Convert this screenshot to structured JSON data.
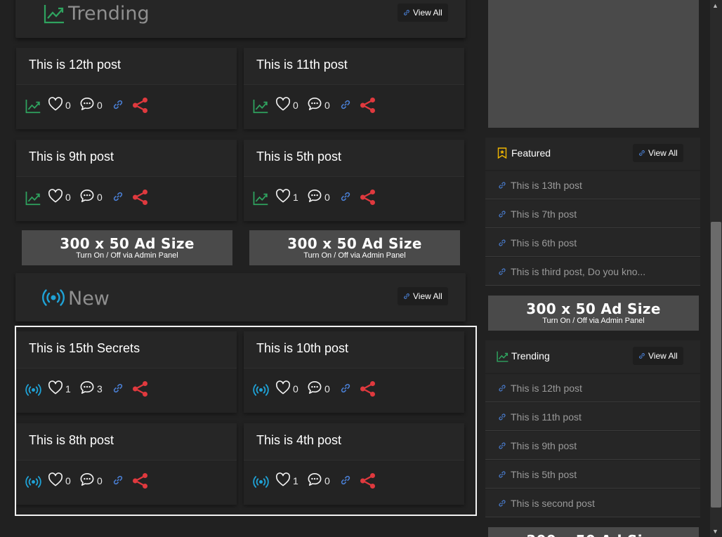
{
  "colors": {
    "trending_green": "#2fa35f",
    "new_blue": "#1fa2d6",
    "share_red": "#e0393e",
    "link_blue": "#4a7fd4",
    "featured_yellow": "#f0b600"
  },
  "trending": {
    "title": "Trending",
    "view_all": "View All",
    "icon": "trending-up-icon",
    "posts": [
      {
        "title": "This is 12th post",
        "likes": "0",
        "comments": "0"
      },
      {
        "title": "This is 11th post",
        "likes": "0",
        "comments": "0"
      },
      {
        "title": "This is 9th post",
        "likes": "0",
        "comments": "0"
      },
      {
        "title": "This is 5th post",
        "likes": "1",
        "comments": "0"
      }
    ]
  },
  "ads": {
    "line1": "300 x 50 Ad Size",
    "line2": "Turn On / Off via Admin Panel"
  },
  "new": {
    "title": "New",
    "view_all": "View All",
    "icon": "broadcast-icon",
    "posts": [
      {
        "title": "This is 15th Secrets",
        "likes": "1",
        "comments": "3"
      },
      {
        "title": "This is 10th post",
        "likes": "0",
        "comments": "0"
      },
      {
        "title": "This is 8th post",
        "likes": "0",
        "comments": "0"
      },
      {
        "title": "This is 4th post",
        "likes": "1",
        "comments": "0"
      }
    ]
  },
  "sidebar": {
    "featured": {
      "title": "Featured",
      "view_all": "View All",
      "items": [
        "This is 13th post",
        "This is 7th post",
        "This is 6th post",
        "This is third post, Do you kno..."
      ]
    },
    "trending": {
      "title": "Trending",
      "view_all": "View All",
      "items": [
        "This is 12th post",
        "This is 11th post",
        "This is 9th post",
        "This is 5th post",
        "This is second post"
      ]
    }
  }
}
